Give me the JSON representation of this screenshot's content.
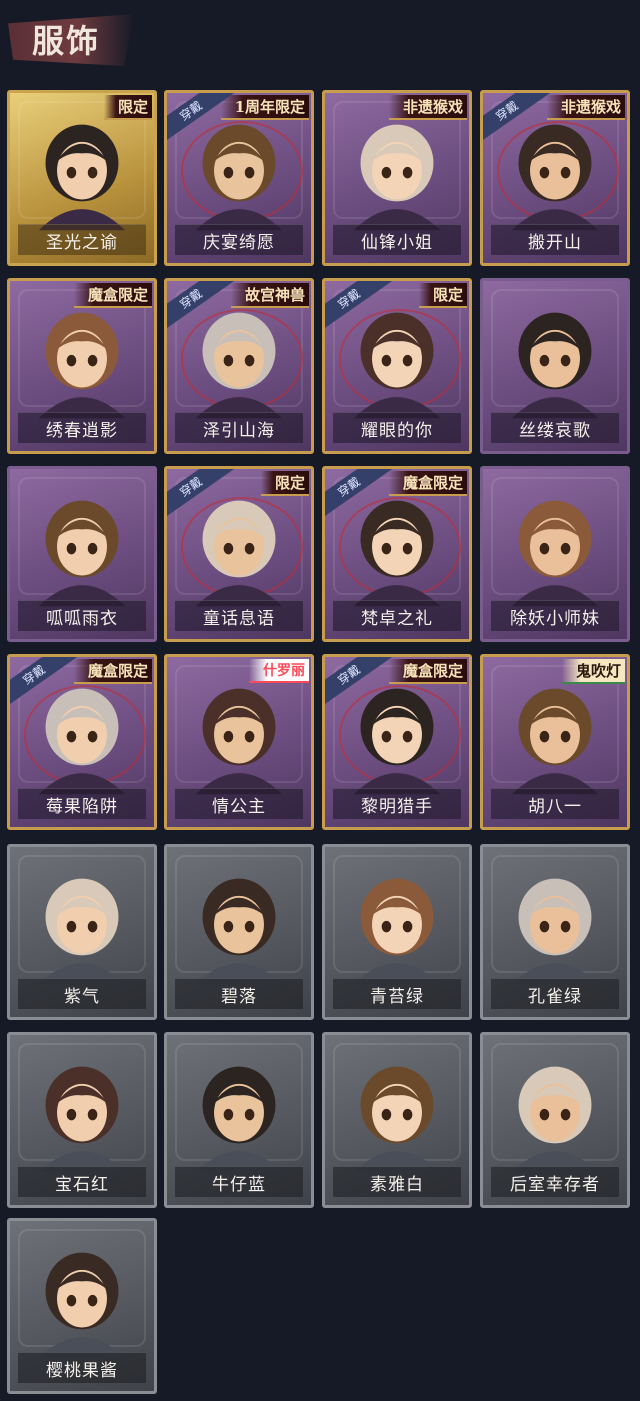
{
  "header": {
    "title": "服饰"
  },
  "colors": {
    "background": "#161a26",
    "gold": "#c79c4c",
    "purple": "#6c4d80",
    "gray": "#53575d"
  },
  "costumes": [
    {
      "label": "圣光之谕",
      "rarity": "gold",
      "badge": "限定",
      "worn": ""
    },
    {
      "label": "庆宴绮愿",
      "rarity": "purple",
      "badge": "1周年限定",
      "worn": "穿戴"
    },
    {
      "label": "仙锋小姐",
      "rarity": "purple",
      "badge": "非遗猴戏",
      "worn": ""
    },
    {
      "label": "搬开山",
      "rarity": "purple",
      "badge": "非遗猴戏",
      "worn": "穿戴"
    },
    {
      "label": "绣春逍影",
      "rarity": "purple",
      "badge": "魔盒限定",
      "worn": ""
    },
    {
      "label": "泽引山海",
      "rarity": "purple",
      "badge": "故宫神兽",
      "worn": "穿戴"
    },
    {
      "label": "耀眼的你",
      "rarity": "purple",
      "badge": "限定",
      "worn": "穿戴"
    },
    {
      "label": "丝缕哀歌",
      "rarity": "purple",
      "badge": "",
      "worn": ""
    },
    {
      "label": "呱呱雨衣",
      "rarity": "purple",
      "badge": "",
      "worn": ""
    },
    {
      "label": "童话息语",
      "rarity": "purple",
      "badge": "限定",
      "worn": "穿戴"
    },
    {
      "label": "梵卓之礼",
      "rarity": "purple",
      "badge": "魔盒限定",
      "worn": "穿戴"
    },
    {
      "label": "除妖小师妹",
      "rarity": "purple",
      "badge": "",
      "worn": ""
    },
    {
      "label": "莓果陷阱",
      "rarity": "purple",
      "badge": "魔盒限定",
      "worn": "穿戴"
    },
    {
      "label": "情公主",
      "rarity": "purple",
      "badge": "什罗丽",
      "worn": ""
    },
    {
      "label": "黎明猎手",
      "rarity": "purple",
      "badge": "魔盒限定",
      "worn": "穿戴"
    },
    {
      "label": "胡八一",
      "rarity": "purple",
      "badge": "鬼吹灯",
      "worn": ""
    },
    {
      "label": "紫气",
      "rarity": "gray",
      "badge": "",
      "worn": ""
    },
    {
      "label": "碧落",
      "rarity": "gray",
      "badge": "",
      "worn": ""
    },
    {
      "label": "青苔绿",
      "rarity": "gray",
      "badge": "",
      "worn": ""
    },
    {
      "label": "孔雀绿",
      "rarity": "gray",
      "badge": "",
      "worn": ""
    },
    {
      "label": "宝石红",
      "rarity": "gray",
      "badge": "",
      "worn": ""
    },
    {
      "label": "牛仔蓝",
      "rarity": "gray",
      "badge": "",
      "worn": ""
    },
    {
      "label": "素雅白",
      "rarity": "gray",
      "badge": "",
      "worn": ""
    },
    {
      "label": "后室幸存者",
      "rarity": "gray",
      "badge": "",
      "worn": ""
    },
    {
      "label": "樱桃果酱",
      "rarity": "gray",
      "badge": "",
      "worn": ""
    }
  ]
}
